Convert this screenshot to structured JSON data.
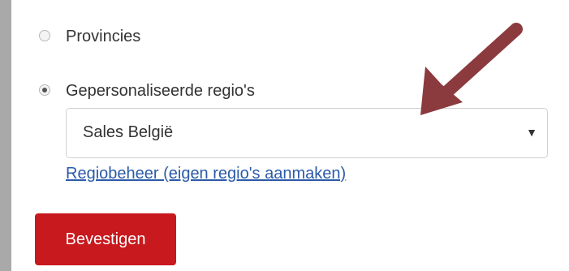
{
  "options": {
    "provinces_label": "Provincies",
    "custom_regions_label": "Gepersonaliseerde regio's",
    "selected": "custom_regions"
  },
  "region_select": {
    "value": "Sales België",
    "caret": "▼"
  },
  "manage_link": "Regiobeheer (eigen regio's aanmaken)",
  "confirm_button": "Bevestigen",
  "colors": {
    "button": "#c8191e",
    "link": "#2b5aa8",
    "annotation_arrow": "#8b3a3e"
  }
}
